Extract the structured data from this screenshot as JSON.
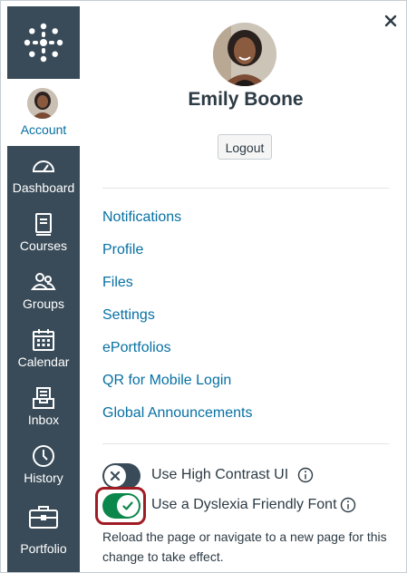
{
  "nav": {
    "account_label": "Account",
    "items": [
      {
        "id": "dashboard",
        "label": "Dashboard",
        "icon": "dashboard-icon"
      },
      {
        "id": "courses",
        "label": "Courses",
        "icon": "courses-icon"
      },
      {
        "id": "groups",
        "label": "Groups",
        "icon": "groups-icon"
      },
      {
        "id": "calendar",
        "label": "Calendar",
        "icon": "calendar-icon"
      },
      {
        "id": "inbox",
        "label": "Inbox",
        "icon": "inbox-icon"
      },
      {
        "id": "history",
        "label": "History",
        "icon": "history-icon"
      },
      {
        "id": "portfolio",
        "label": "Portfolio",
        "icon": "portfolio-icon"
      }
    ],
    "colors": {
      "background": "#394b58",
      "active_background": "#ffffff",
      "active_text": "#0770a3"
    }
  },
  "tray": {
    "close_icon": "close-icon",
    "user_name": "Emily Boone",
    "logout_label": "Logout",
    "links": [
      "Notifications",
      "Profile",
      "Files",
      "Settings",
      "ePortfolios",
      "QR for Mobile Login",
      "Global Announcements"
    ],
    "toggles": [
      {
        "label": "Use High Contrast UI",
        "state": "off"
      },
      {
        "label": "Use a Dyslexia Friendly Font",
        "state": "on"
      }
    ],
    "help_text": "Reload the page or navigate to a new page for this change to take effect.",
    "colors": {
      "link": "#0770a3",
      "toggle_on": "#0b874b",
      "toggle_off": "#394b58",
      "focus_ring": "#a01c25"
    }
  }
}
